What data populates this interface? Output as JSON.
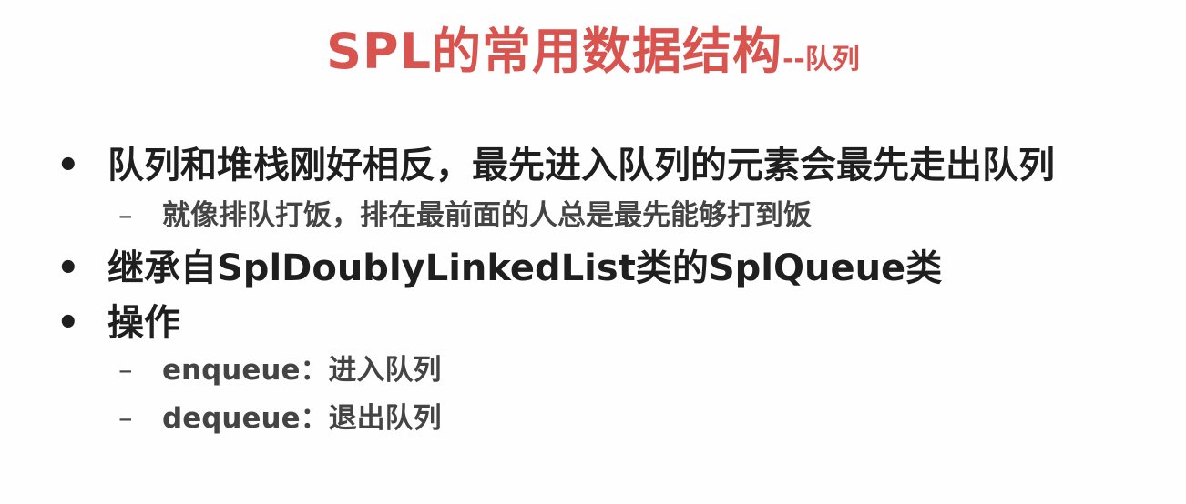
{
  "title": {
    "main": "SPL的常用数据结构",
    "suffix": "--队列"
  },
  "bullets": [
    {
      "marker": "•",
      "text": "队列和堆栈刚好相反，最先进入队列的元素会最先走出队列"
    },
    {
      "marker": "–",
      "text": "就像排队打饭，排在最前面的人总是最先能够打到饭"
    },
    {
      "marker": "•",
      "text": "继承自SplDoublyLinkedList类的SplQueue类"
    },
    {
      "marker": "•",
      "text": "操作"
    },
    {
      "marker": "–",
      "text": "enqueue：进入队列"
    },
    {
      "marker": "–",
      "text": "dequeue：退出队列"
    }
  ]
}
